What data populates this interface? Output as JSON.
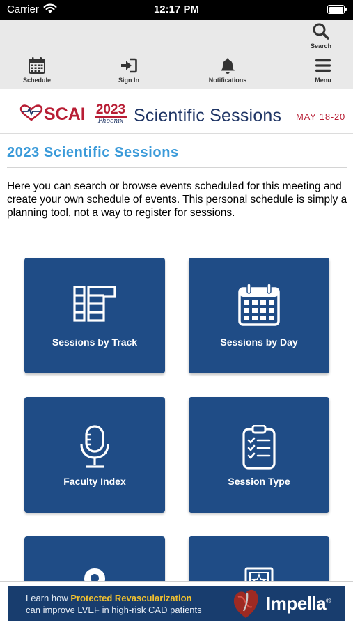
{
  "status_bar": {
    "carrier": "Carrier",
    "time": "12:17 PM"
  },
  "toolbar": {
    "search_label": "Search",
    "schedule_label": "Schedule",
    "signin_label": "Sign In",
    "notifications_label": "Notifications",
    "menu_label": "Menu",
    "icons": [
      "search-icon",
      "calendar-icon",
      "sign-in-icon",
      "bell-icon",
      "hamburger-menu-icon"
    ]
  },
  "banner": {
    "scai": "SCAI",
    "year": "2023",
    "city": "Phoenix",
    "title": "Scientific Sessions",
    "dates": "MAY 18-20"
  },
  "content": {
    "title": "2023 Scientific Sessions",
    "intro": "Here you can search or browse events scheduled for this meeting and create your own schedule of events. This personal schedule is simply a planning tool, not a way to register for sessions."
  },
  "tiles": [
    {
      "label": "Sessions by Track",
      "icon": "track-layout-icon"
    },
    {
      "label": "Sessions by Day",
      "icon": "calendar-icon"
    },
    {
      "label": "Faculty Index",
      "icon": "microphone-icon"
    },
    {
      "label": "Session Type",
      "icon": "clipboard-checklist-icon"
    },
    {
      "label": "",
      "icon": "map-pin-icon"
    },
    {
      "label": "",
      "icon": "framed-star-icon"
    }
  ],
  "ad": {
    "line1_prefix": "Learn how ",
    "line1_highlight": "Protected Revascularization",
    "line2": "can improve LVEF in high-risk CAD patients",
    "brand": "Impella",
    "brand_mark": "®"
  },
  "colors": {
    "tile_blue": "#1f4c86",
    "title_blue": "#3a9ad9",
    "brand_red": "#b81d34",
    "brand_navy": "#1f3565",
    "toolbar_bg": "#e9e9e9",
    "ad_highlight": "#f2c12e"
  }
}
